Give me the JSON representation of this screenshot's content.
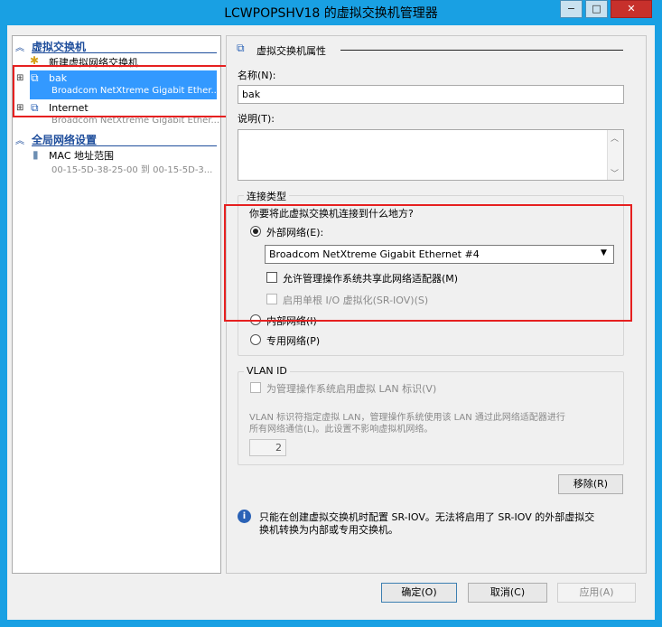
{
  "window": {
    "title": "LCWPOPSHV18 的虚拟交换机管理器",
    "controls": [
      "−",
      "□",
      "✕"
    ]
  },
  "sidebar": {
    "virtual_switches_header": "虚拟交换机",
    "new_switch": "新建虚拟网络交换机",
    "items": [
      {
        "name": "bak",
        "sub": "Broadcom NetXtreme Gigabit Ether..."
      },
      {
        "name": "Internet",
        "sub": "Broadcom NetXtreme Gigabit Ether..."
      }
    ],
    "global_header": "全局网络设置",
    "mac": {
      "name": "MAC 地址范围",
      "sub": "00-15-5D-38-25-00 到 00-15-5D-3..."
    }
  },
  "props": {
    "header": "虚拟交换机属性",
    "name_label": "名称(N):",
    "name_value": "bak",
    "desc_label": "说明(T):",
    "conn_group": "连接类型",
    "conn_question": "你要将此虚拟交换机连接到什么地方?",
    "external": "外部网络(E):",
    "adapter": "Broadcom NetXtreme Gigabit Ethernet #4",
    "allow_mgmt": "允许管理操作系统共享此网络适配器(M)",
    "sriov": "启用单根 I/O 虚拟化(SR-IOV)(S)",
    "internal": "内部网络(I)",
    "private": "专用网络(P)",
    "vlan_group": "VLAN ID",
    "vlan_check": "为管理操作系统启用虚拟 LAN 标识(V)",
    "vlan_desc1": "VLAN 标识符指定虚拟 LAN，管理操作系统使用该 LAN 通过此网络适配器进行",
    "vlan_desc2": "所有网络通信(L)。此设置不影响虚拟机网络。",
    "vlan_value": "2",
    "remove": "移除(R)",
    "info1": "只能在创建虚拟交换机时配置 SR-IOV。无法将启用了 SR-IOV 的外部虚拟交",
    "info2": "换机转换为内部或专用交换机。"
  },
  "footer": {
    "ok": "确定(O)",
    "cancel": "取消(C)",
    "apply": "应用(A)"
  }
}
